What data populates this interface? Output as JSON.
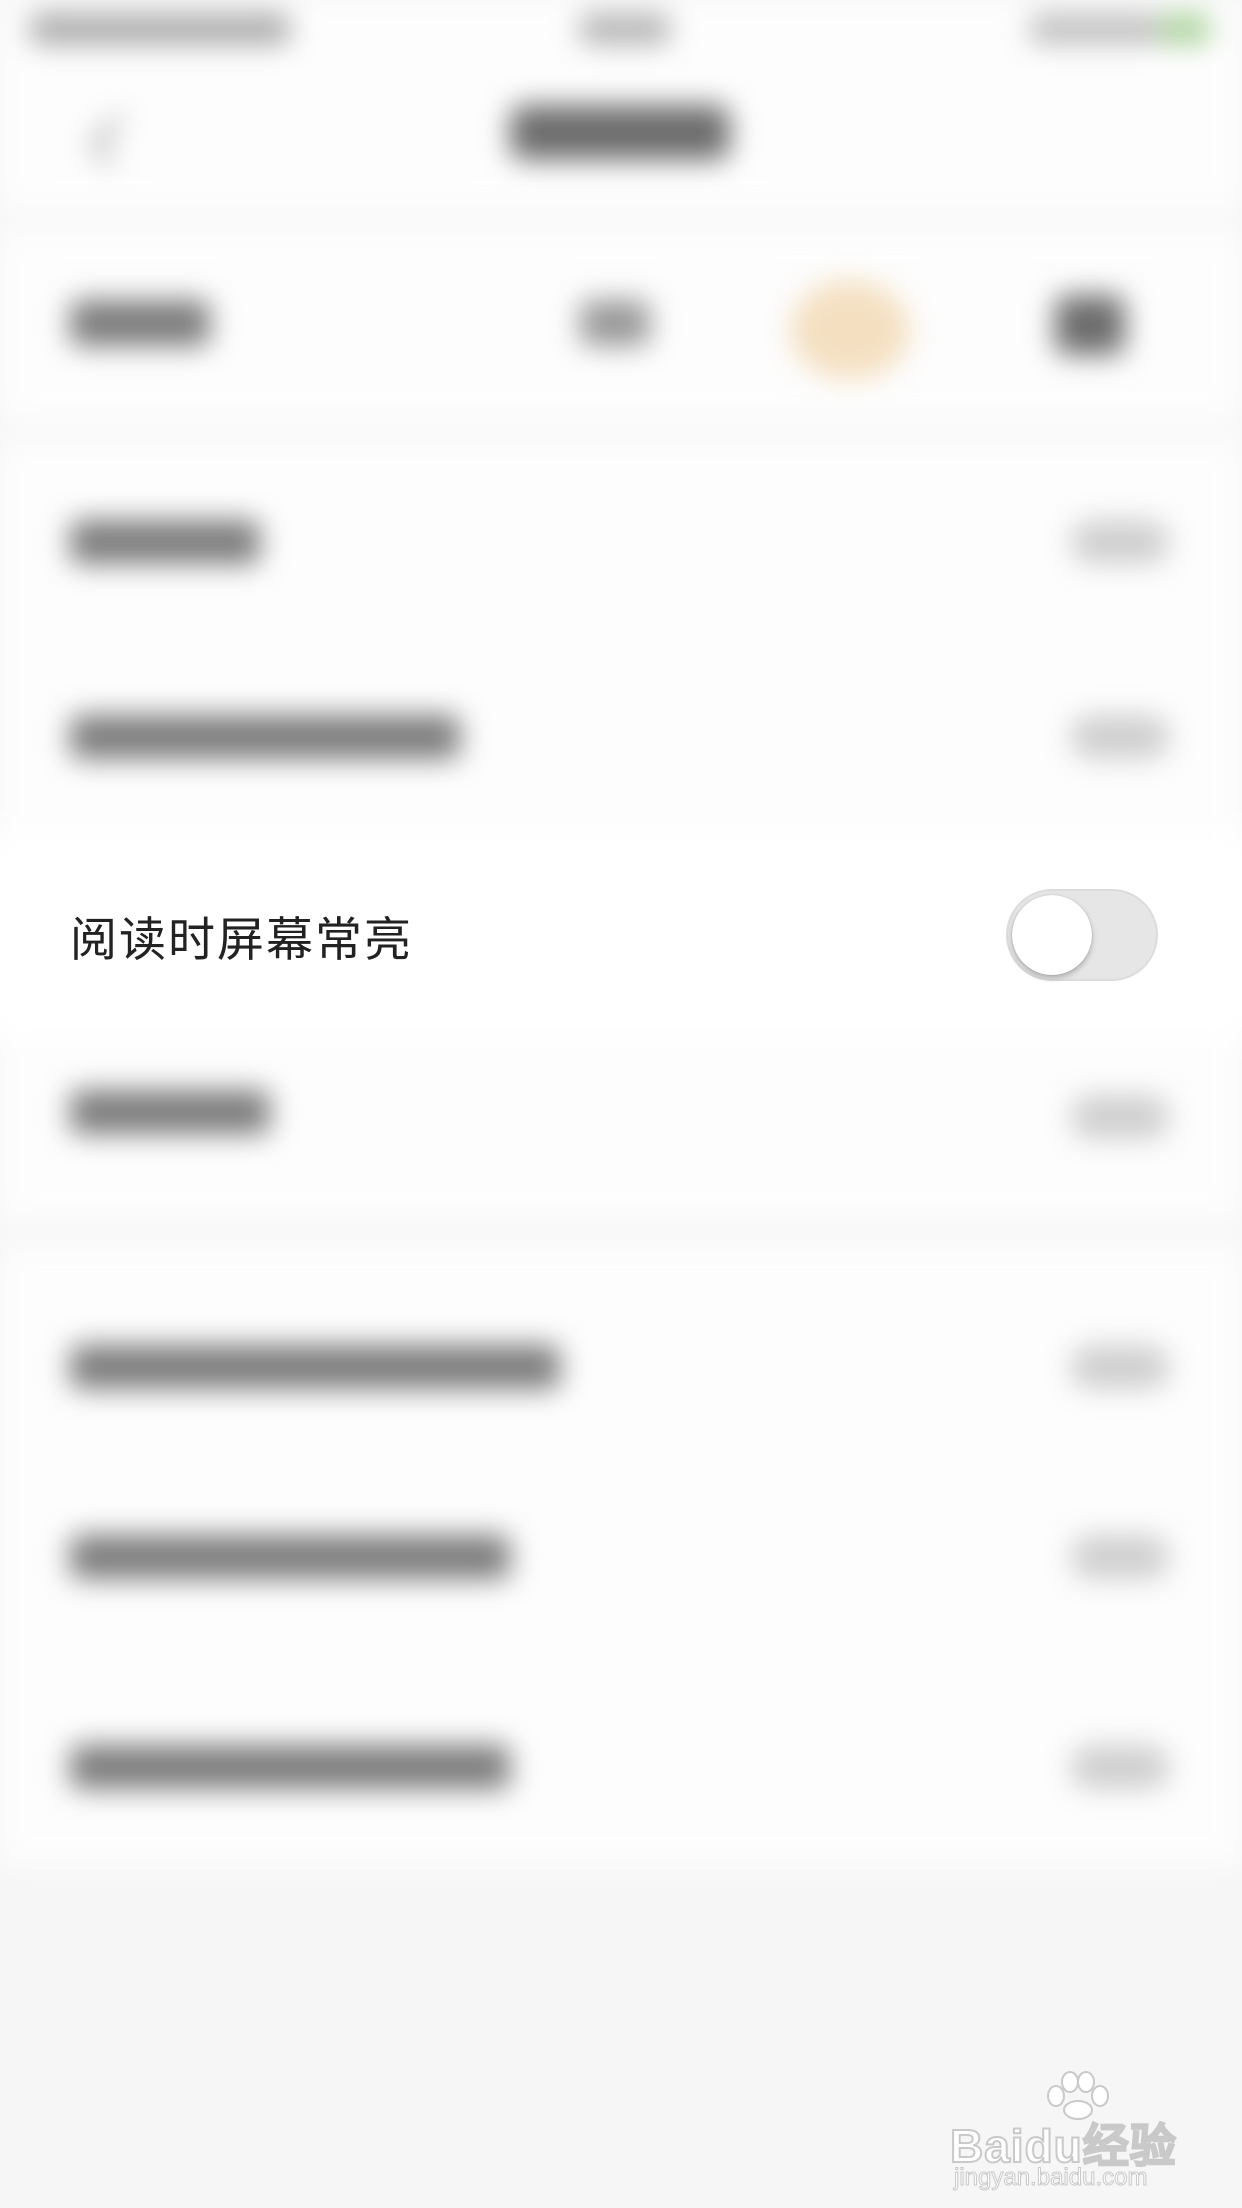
{
  "setting_row": {
    "label": "阅读时屏幕常亮",
    "toggle_state": "off"
  },
  "watermark": {
    "logo": "Baidu经验",
    "url": "jingyan.baidu.com"
  },
  "colors": {
    "background": "#f6f6f6",
    "toggle_track_off": "#e6e6e6",
    "toggle_knob": "#ffffff",
    "label_text": "#222222"
  },
  "icons": [
    "back-arrow-icon",
    "baidu-paw-icon"
  ]
}
